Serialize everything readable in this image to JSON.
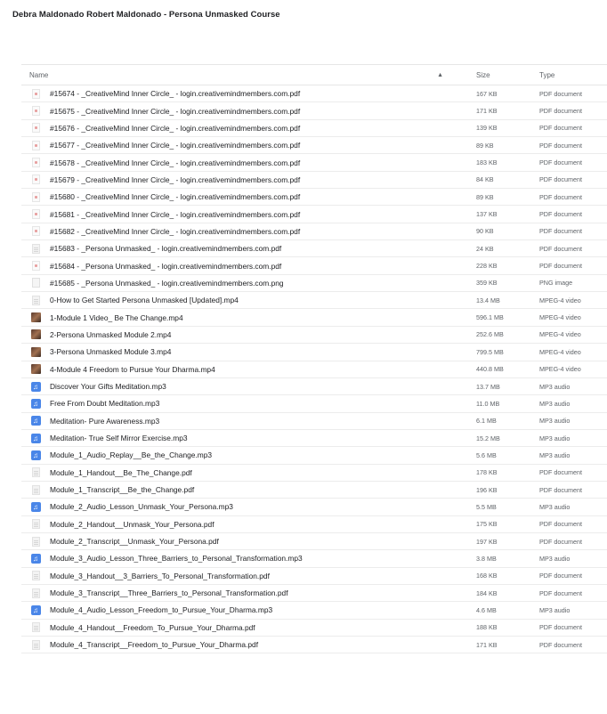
{
  "page": {
    "title": "Debra Maldonado Robert Maldonado - Persona Unmasked Course"
  },
  "table": {
    "headers": {
      "name": "Name",
      "size": "Size",
      "type": "Type"
    },
    "sort_icon": "arrow-up-icon",
    "rows": [
      {
        "name": "#15674 - _CreativeMind Inner Circle_ - login.creativemindmembers.com.pdf",
        "size": "167 KB",
        "type": "PDF document",
        "icon": "pdf"
      },
      {
        "name": "#15675 - _CreativeMind Inner Circle_ - login.creativemindmembers.com.pdf",
        "size": "171 KB",
        "type": "PDF document",
        "icon": "pdf"
      },
      {
        "name": "#15676 - _CreativeMind Inner Circle_ - login.creativemindmembers.com.pdf",
        "size": "139 KB",
        "type": "PDF document",
        "icon": "pdf"
      },
      {
        "name": "#15677 - _CreativeMind Inner Circle_ - login.creativemindmembers.com.pdf",
        "size": "89 KB",
        "type": "PDF document",
        "icon": "pdf"
      },
      {
        "name": "#15678 - _CreativeMind Inner Circle_ - login.creativemindmembers.com.pdf",
        "size": "183 KB",
        "type": "PDF document",
        "icon": "pdf"
      },
      {
        "name": "#15679 - _CreativeMind Inner Circle_ - login.creativemindmembers.com.pdf",
        "size": "84 KB",
        "type": "PDF document",
        "icon": "pdf"
      },
      {
        "name": "#15680 - _CreativeMind Inner Circle_ - login.creativemindmembers.com.pdf",
        "size": "89 KB",
        "type": "PDF document",
        "icon": "pdf"
      },
      {
        "name": "#15681 - _CreativeMind Inner Circle_ - login.creativemindmembers.com.pdf",
        "size": "137 KB",
        "type": "PDF document",
        "icon": "pdf"
      },
      {
        "name": "#15682 - _CreativeMind Inner Circle_ - login.creativemindmembers.com.pdf",
        "size": "90 KB",
        "type": "PDF document",
        "icon": "pdf"
      },
      {
        "name": "#15683 - _Persona Unmasked_ - login.creativemindmembers.com.pdf",
        "size": "24 KB",
        "type": "PDF document",
        "icon": "doc"
      },
      {
        "name": "#15684 - _Persona Unmasked_ - login.creativemindmembers.com.pdf",
        "size": "228 KB",
        "type": "PDF document",
        "icon": "pdf"
      },
      {
        "name": "#15685 - _Persona Unmasked_ - login.creativemindmembers.com.png",
        "size": "359 KB",
        "type": "PNG image",
        "icon": "image"
      },
      {
        "name": "0-How to Get Started Persona Unmasked [Updated].mp4",
        "size": "13.4 MB",
        "type": "MPEG-4 video",
        "icon": "doc"
      },
      {
        "name": "1-Module 1 Video_ Be The Change.mp4",
        "size": "596.1 MB",
        "type": "MPEG-4 video",
        "icon": "video"
      },
      {
        "name": "2-Persona Unmasked Module 2.mp4",
        "size": "252.6 MB",
        "type": "MPEG-4 video",
        "icon": "video"
      },
      {
        "name": "3-Persona Unmasked Module 3.mp4",
        "size": "799.5 MB",
        "type": "MPEG-4 video",
        "icon": "video"
      },
      {
        "name": "4-Module 4 Freedom to Pursue Your Dharma.mp4",
        "size": "440.8 MB",
        "type": "MPEG-4 video",
        "icon": "video"
      },
      {
        "name": "Discover Your Gifts Meditation.mp3",
        "size": "13.7 MB",
        "type": "MP3 audio",
        "icon": "audio"
      },
      {
        "name": "Free From Doubt Meditation.mp3",
        "size": "11.0 MB",
        "type": "MP3 audio",
        "icon": "audio"
      },
      {
        "name": "Meditation- Pure Awareness.mp3",
        "size": "6.1 MB",
        "type": "MP3 audio",
        "icon": "audio"
      },
      {
        "name": "Meditation- True Self Mirror Exercise.mp3",
        "size": "15.2 MB",
        "type": "MP3 audio",
        "icon": "audio"
      },
      {
        "name": "Module_1_Audio_Replay__Be_the_Change.mp3",
        "size": "5.6 MB",
        "type": "MP3 audio",
        "icon": "audio"
      },
      {
        "name": "Module_1_Handout__Be_The_Change.pdf",
        "size": "178 KB",
        "type": "PDF document",
        "icon": "doc"
      },
      {
        "name": "Module_1_Transcript__Be_the_Change.pdf",
        "size": "196 KB",
        "type": "PDF document",
        "icon": "doc"
      },
      {
        "name": "Module_2_Audio_Lesson_Unmask_Your_Persona.mp3",
        "size": "5.5 MB",
        "type": "MP3 audio",
        "icon": "audio"
      },
      {
        "name": "Module_2_Handout__Unmask_Your_Persona.pdf",
        "size": "175 KB",
        "type": "PDF document",
        "icon": "doc"
      },
      {
        "name": "Module_2_Transcript__Unmask_Your_Persona.pdf",
        "size": "197 KB",
        "type": "PDF document",
        "icon": "doc"
      },
      {
        "name": "Module_3_Audio_Lesson_Three_Barriers_to_Personal_Transformation.mp3",
        "size": "3.8 MB",
        "type": "MP3 audio",
        "icon": "audio"
      },
      {
        "name": "Module_3_Handout__3_Barriers_To_Personal_Transformation.pdf",
        "size": "168 KB",
        "type": "PDF document",
        "icon": "doc"
      },
      {
        "name": "Module_3_Transcript__Three_Barriers_to_Personal_Transformation.pdf",
        "size": "184 KB",
        "type": "PDF document",
        "icon": "doc"
      },
      {
        "name": "Module_4_Audio_Lesson_Freedom_to_Pursue_Your_Dharma.mp3",
        "size": "4.6 MB",
        "type": "MP3 audio",
        "icon": "audio"
      },
      {
        "name": "Module_4_Handout__Freedom_To_Pursue_Your_Dharma.pdf",
        "size": "188 KB",
        "type": "PDF document",
        "icon": "doc"
      },
      {
        "name": "Module_4_Transcript__Freedom_to_Pursue_Your_Dharma.pdf",
        "size": "171 KB",
        "type": "PDF document",
        "icon": "doc"
      }
    ]
  }
}
